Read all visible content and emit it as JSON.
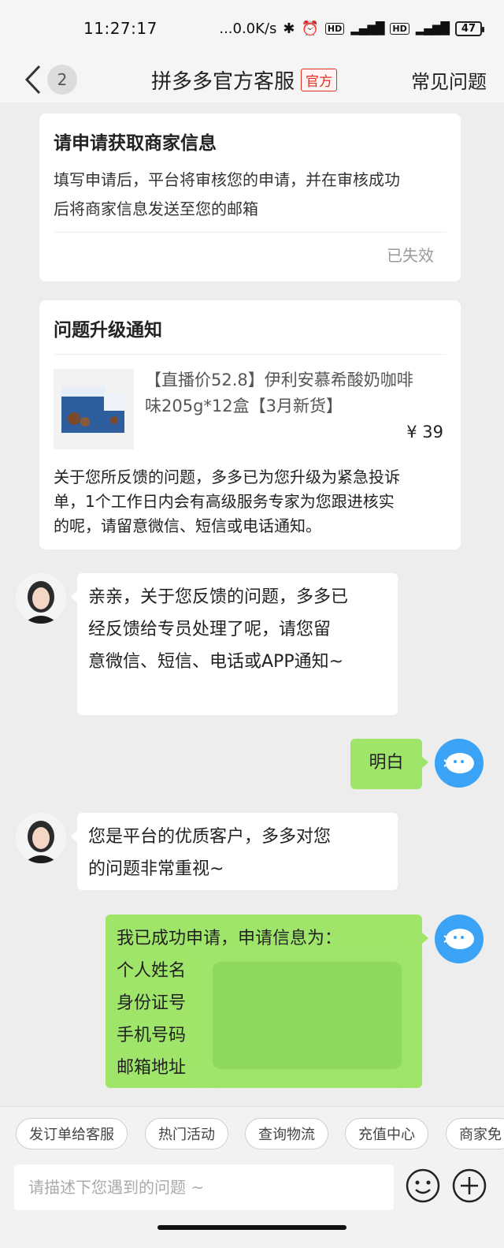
{
  "status_bar": {
    "time": "11:27:17",
    "net_speed": "...0.0K/s",
    "battery": "47"
  },
  "nav": {
    "unread_count": "2",
    "title": "拼多多官方客服",
    "official_tag": "官方",
    "faq": "常见问题"
  },
  "card_merchant": {
    "title": "请申请获取商家信息",
    "body_line1": "填写申请后，平台将审核您的申请，并在审核成功",
    "body_line2": "后将商家信息发送至您的邮箱",
    "status": "已失效"
  },
  "card_escalation": {
    "title": "问题升级通知",
    "product_name_line1": "【直播价52.8】伊利安慕希酸奶咖啡",
    "product_name_line2": "味205g*12盒【3月新货】",
    "product_price": "¥ 39",
    "text_line1": "关于您所反馈的问题，多多已为您升级为紧急投诉",
    "text_line2": "单，1个工作日内会有高级服务专家为您跟进核实",
    "text_line3": "的呢，请留意微信、短信或电话通知。"
  },
  "messages": {
    "agent1_line1": "亲亲，关于您反馈的问题，多多已",
    "agent1_line2": "经反馈给专员处理了呢，请您留",
    "agent1_line3": "意微信、短信、电话或APP通知~",
    "user1": "明白",
    "agent2_line1": "您是平台的优质客户，多多对您",
    "agent2_line2": "的问题非常重视~",
    "user2_line1": "我已成功申请，申请信息为：",
    "user2_name_label": "个人姓名",
    "user2_id_label": "身份证号",
    "user2_phone_label": "手机号码",
    "user2_email_label": "邮箱地址"
  },
  "quick_replies": [
    "发订单给客服",
    "热门活动",
    "查询物流",
    "充值中心",
    "商家免"
  ],
  "input": {
    "placeholder": "请描述下您遇到的问题 ~"
  },
  "colors": {
    "brand_red": "#e02e24",
    "user_bubble": "#9fe56a",
    "user_avatar": "#3aa3f5"
  }
}
